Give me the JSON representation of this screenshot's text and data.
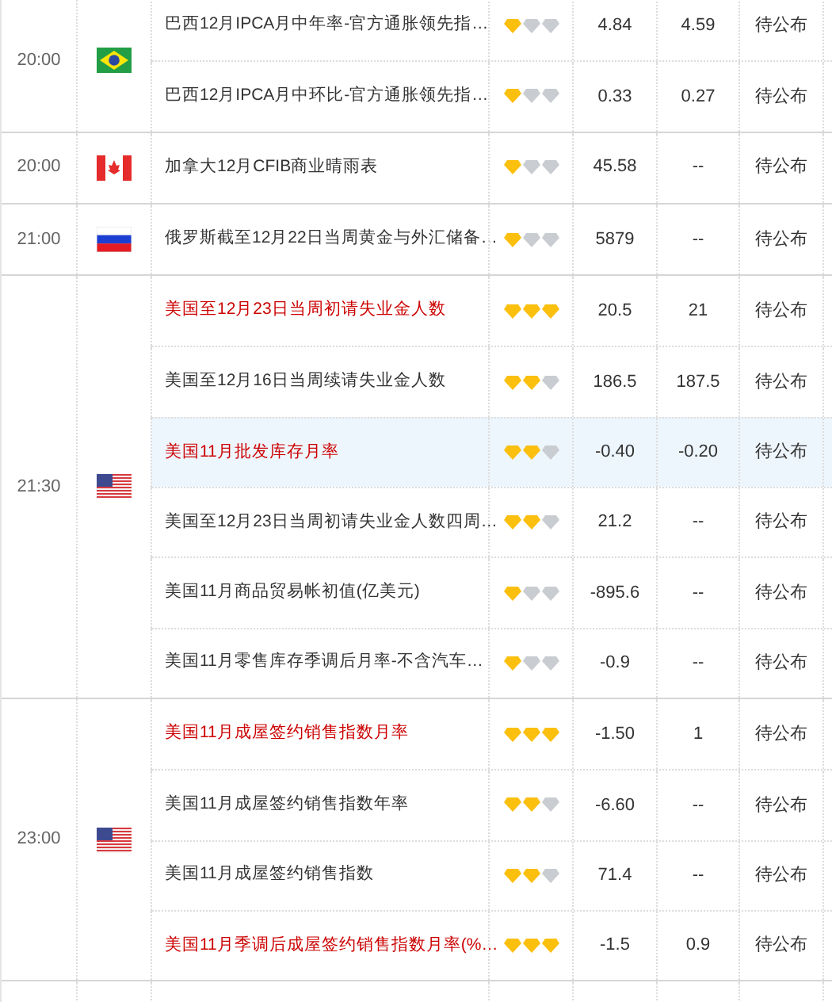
{
  "groups": [
    {
      "time": "20:00",
      "flag": {
        "kind": "brazil"
      },
      "events": [
        {
          "name": "巴西12月IPCA月中年率-官方通胀领先指…",
          "important": false,
          "selected": false,
          "stars": 1,
          "previous": "4.84",
          "forecast": "4.59",
          "actual": "待公布"
        },
        {
          "name": "巴西12月IPCA月中环比-官方通胀领先指…",
          "important": false,
          "selected": false,
          "stars": 1,
          "previous": "0.33",
          "forecast": "0.27",
          "actual": "待公布"
        }
      ]
    },
    {
      "time": "20:00",
      "flag": {
        "kind": "canada"
      },
      "events": [
        {
          "name": "加拿大12月CFIB商业晴雨表",
          "important": false,
          "selected": false,
          "stars": 1,
          "previous": "45.58",
          "forecast": "--",
          "actual": "待公布"
        }
      ]
    },
    {
      "time": "21:00",
      "flag": {
        "kind": "russia"
      },
      "events": [
        {
          "name": "俄罗斯截至12月22日当周黄金与外汇储备…",
          "important": false,
          "selected": false,
          "stars": 1,
          "previous": "5879",
          "forecast": "--",
          "actual": "待公布"
        }
      ]
    },
    {
      "time": "21:30",
      "flag": {
        "kind": "usa"
      },
      "events": [
        {
          "name": "美国至12月23日当周初请失业金人数",
          "important": true,
          "selected": false,
          "stars": 3,
          "previous": "20.5",
          "forecast": "21",
          "actual": "待公布"
        },
        {
          "name": "美国至12月16日当周续请失业金人数",
          "important": false,
          "selected": false,
          "stars": 2,
          "previous": "186.5",
          "forecast": "187.5",
          "actual": "待公布"
        },
        {
          "name": "美国11月批发库存月率",
          "important": true,
          "selected": true,
          "stars": 2,
          "previous": "-0.40",
          "forecast": "-0.20",
          "actual": "待公布"
        },
        {
          "name": "美国至12月23日当周初请失业金人数四周…",
          "important": false,
          "selected": false,
          "stars": 2,
          "previous": "21.2",
          "forecast": "--",
          "actual": "待公布"
        },
        {
          "name": "美国11月商品贸易帐初值(亿美元)",
          "important": false,
          "selected": false,
          "stars": 1,
          "previous": "-895.6",
          "forecast": "--",
          "actual": "待公布"
        },
        {
          "name": "美国11月零售库存季调后月率-不含汽车…",
          "important": false,
          "selected": false,
          "stars": 1,
          "previous": "-0.9",
          "forecast": "--",
          "actual": "待公布"
        }
      ]
    },
    {
      "time": "23:00",
      "flag": {
        "kind": "usa"
      },
      "events": [
        {
          "name": "美国11月成屋签约销售指数月率",
          "important": true,
          "selected": false,
          "stars": 3,
          "previous": "-1.50",
          "forecast": "1",
          "actual": "待公布"
        },
        {
          "name": "美国11月成屋签约销售指数年率",
          "important": false,
          "selected": false,
          "stars": 2,
          "previous": "-6.60",
          "forecast": "--",
          "actual": "待公布"
        },
        {
          "name": "美国11月成屋签约销售指数",
          "important": false,
          "selected": false,
          "stars": 2,
          "previous": "71.4",
          "forecast": "--",
          "actual": "待公布"
        },
        {
          "name": "美国11月季调后成屋签约销售指数月率(%…",
          "important": true,
          "selected": false,
          "stars": 3,
          "previous": "-1.5",
          "forecast": "0.9",
          "actual": "待公布"
        }
      ]
    }
  ]
}
